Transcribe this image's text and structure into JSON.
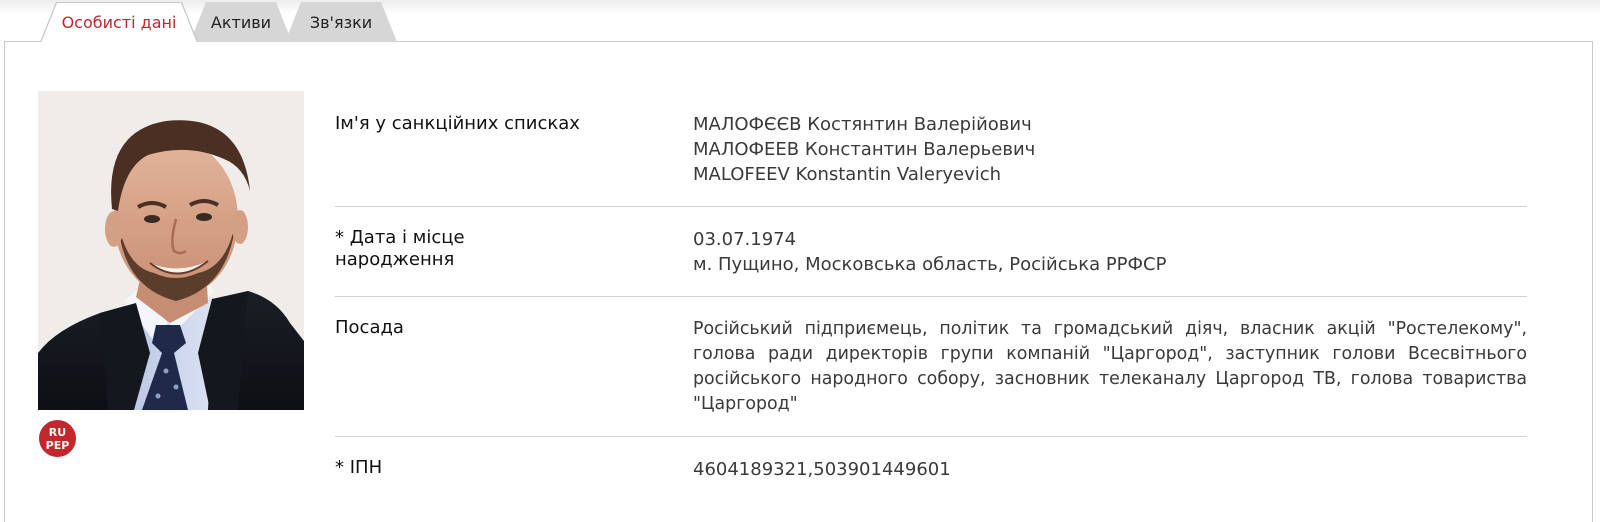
{
  "tabs": [
    {
      "label": "Особисті дані",
      "active": true
    },
    {
      "label": "Активи",
      "active": false
    },
    {
      "label": "Зв'язки",
      "active": false
    }
  ],
  "badge": {
    "line1": "RU",
    "line2": "PEP"
  },
  "fields": [
    {
      "label": "Ім'я у санкційних списках",
      "values": [
        "МАЛОФЄЄВ Костянтин Валерійович",
        "МАЛОФЕЕВ Константин Валерьевич",
        "MALOFEEV Konstantin Valeryevich"
      ]
    },
    {
      "label_lines": [
        "* Дата і місце",
        "народження"
      ],
      "values": [
        "03.07.1974",
        "м. Пущино, Московська область, Російська РРФСР"
      ]
    },
    {
      "label": "Посада",
      "text": "Російський підприємець, політик та громадський діяч, власник акцій \"Ростелекому\", голова ради директорів групи компаній \"Царгород\", заступник голови Всесвітнього російського народного собору, засновник телеканалу Царгород ТВ, голова товариства \"Царгород\""
    },
    {
      "label": "* ІПН",
      "values": [
        "4604189321,503901449601"
      ]
    }
  ],
  "colors": {
    "accent": "#c0272d",
    "tab_bg": "#d6d6d6",
    "divider": "#d2d2d2"
  }
}
